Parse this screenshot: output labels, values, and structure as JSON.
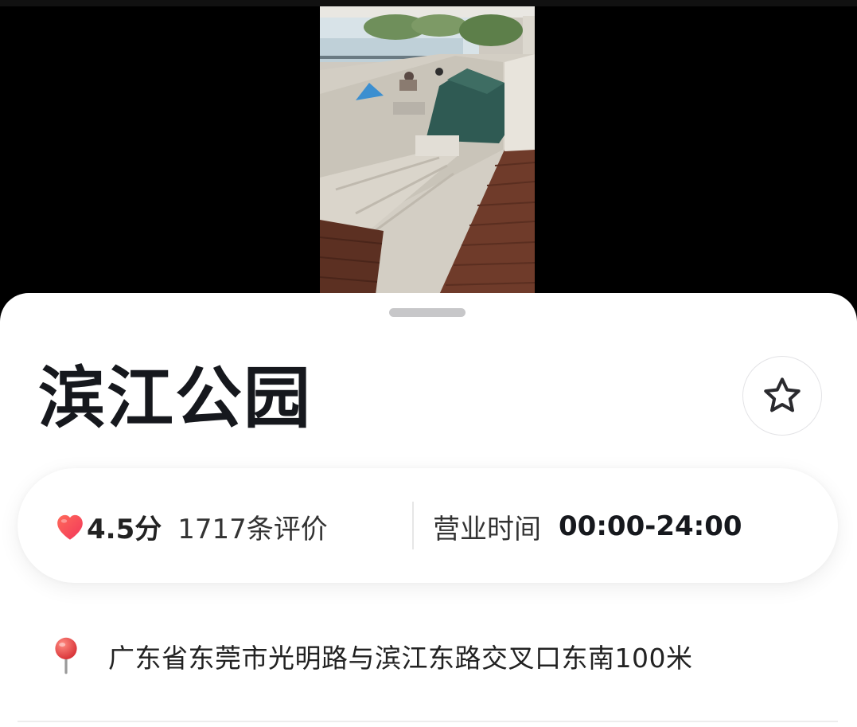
{
  "place": {
    "name": "滨江公园",
    "favorite_icon": "star-outline-icon"
  },
  "info": {
    "rating_icon": "heart-icon",
    "score": "4.5分",
    "reviews": "1717条评价",
    "hours_label": "营业时间",
    "hours_value": "00:00-24:00"
  },
  "address": {
    "icon": "map-pin-icon",
    "text": "广东省东莞市光明路与滨江东路交叉口东南100米"
  },
  "colors": {
    "heart": "#f5475c",
    "pin": "#e8383d",
    "title": "#16181d",
    "sheet_background": "#ffffff",
    "media_background": "#000000"
  }
}
